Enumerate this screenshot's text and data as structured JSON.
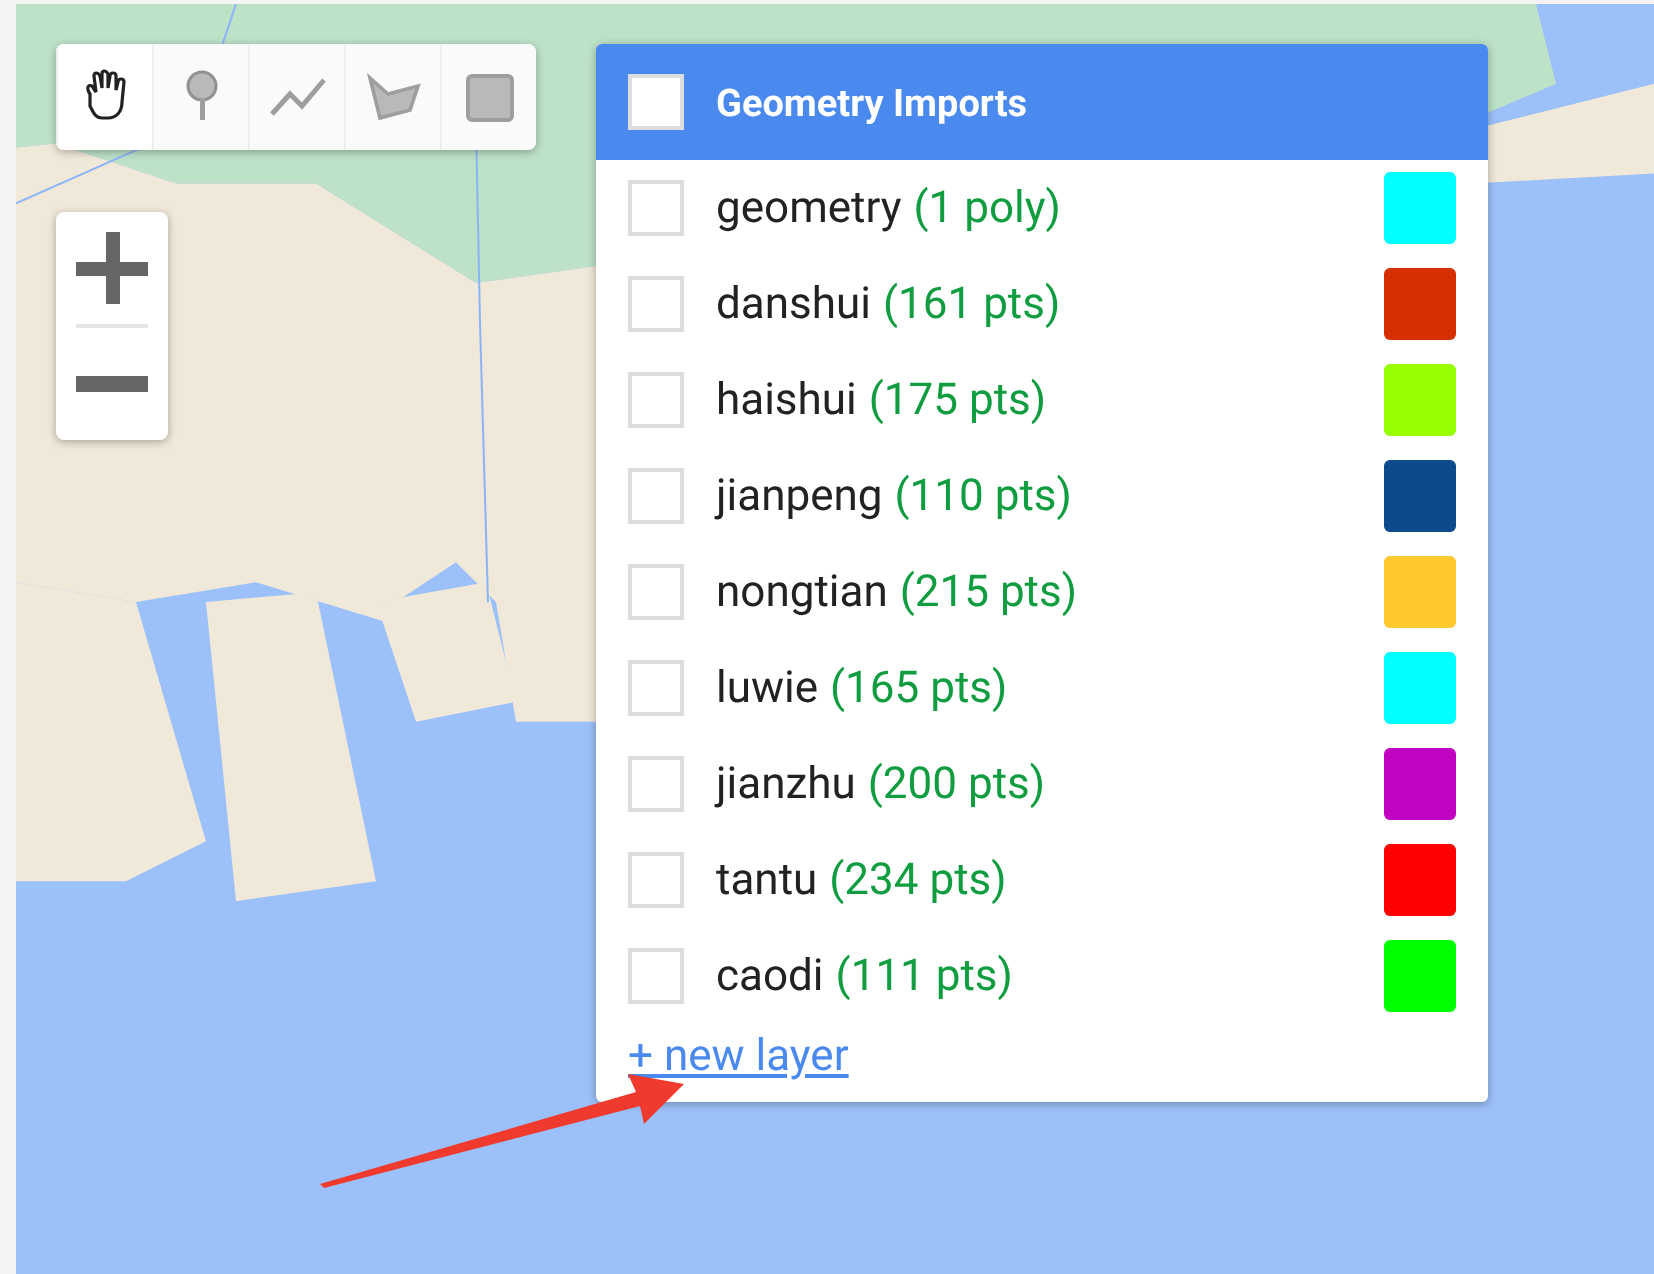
{
  "drawing_tools": [
    {
      "kind": "hand",
      "selected": true
    },
    {
      "kind": "point",
      "selected": false
    },
    {
      "kind": "line",
      "selected": false
    },
    {
      "kind": "polygon",
      "selected": false
    },
    {
      "kind": "rectangle",
      "selected": false
    }
  ],
  "zoom_controls": [
    {
      "kind": "in"
    },
    {
      "kind": "out"
    }
  ],
  "geometry_imports": {
    "title": "Geometry Imports",
    "checked": false,
    "layers": [
      {
        "name": "geometry",
        "count": "(1 poly)",
        "checked": false,
        "color": "#00ffff"
      },
      {
        "name": "danshui",
        "count": "(161 pts)",
        "checked": false,
        "color": "#d63000"
      },
      {
        "name": "haishui",
        "count": "(175 pts)",
        "checked": false,
        "color": "#98ff00"
      },
      {
        "name": "jianpeng",
        "count": "(110 pts)",
        "checked": false,
        "color": "#0b4a8b"
      },
      {
        "name": "nongtian",
        "count": "(215 pts)",
        "checked": false,
        "color": "#ffc82d"
      },
      {
        "name": "luwie",
        "count": "(165 pts)",
        "checked": false,
        "color": "#00ffff"
      },
      {
        "name": "jianzhu",
        "count": "(200 pts)",
        "checked": false,
        "color": "#bf04c2"
      },
      {
        "name": "tantu",
        "count": "(234 pts)",
        "checked": false,
        "color": "#ff0000"
      },
      {
        "name": "caodi",
        "count": "(111 pts)",
        "checked": false,
        "color": "#00ff00"
      }
    ],
    "new_layer_link": "+ new layer"
  },
  "annotation": {
    "kind": "arrow"
  }
}
